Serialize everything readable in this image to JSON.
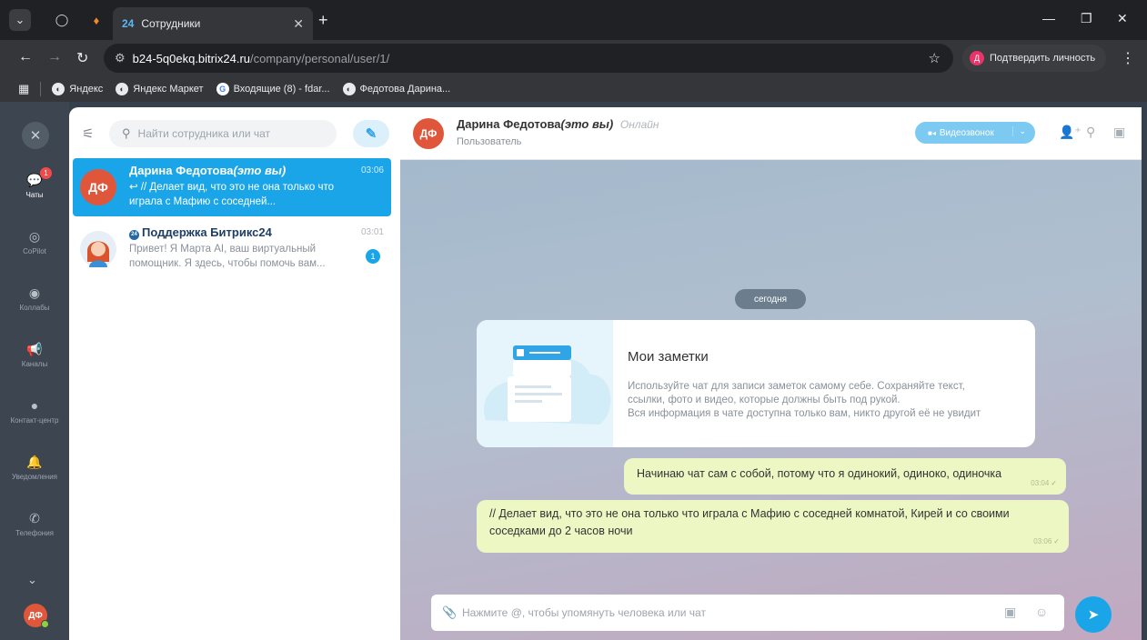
{
  "browser": {
    "tab_title": "Сотрудники",
    "tab_favicon": "24",
    "url_host": "b24-5q0ekq.bitrix24.ru",
    "url_path": "/company/personal/user/1/",
    "verify_avatar": "Д",
    "verify_label": "Подтвердить личность",
    "bookmarks": [
      {
        "label": "Яндекс",
        "icon": "yandex-icon"
      },
      {
        "label": "Яндекс Маркет",
        "icon": "yandex-market-icon"
      },
      {
        "label": "Входящие (8) - fdar...",
        "icon": "google-icon"
      },
      {
        "label": "Федотова Дарина...",
        "icon": "globe-icon"
      }
    ]
  },
  "leftnav": {
    "items": [
      {
        "label": "Чаты",
        "icon": "chat-icon",
        "badge": "1",
        "active": true
      },
      {
        "label": "CoPilot",
        "icon": "copilot-icon"
      },
      {
        "label": "Коллабы",
        "icon": "collab-icon"
      },
      {
        "label": "Каналы",
        "icon": "megaphone-icon"
      },
      {
        "label": "Контакт-центр",
        "icon": "contact-center-icon"
      },
      {
        "label": "Уведомления",
        "icon": "bell-icon"
      },
      {
        "label": "Телефония",
        "icon": "phone-icon"
      }
    ],
    "user_initials": "ДФ"
  },
  "chatlist": {
    "search_placeholder": "Найти сотрудника или чат",
    "chats": [
      {
        "name": "Дарина Федотова",
        "name_suffix": "(это вы)",
        "initials": "ДФ",
        "time": "03:06",
        "preview": "// Делает вид, что это не она только что играла с Мафию с соседней...",
        "reply_mark": "↩"
      },
      {
        "name": "Поддержка Битрикс24",
        "badge": "24",
        "time": "03:01",
        "preview": "Привет! Я Марта AI, ваш виртуальный помощник. Я здесь, чтобы помочь вам...",
        "unread": "1"
      }
    ]
  },
  "chat": {
    "header": {
      "initials": "ДФ",
      "name": "Дарина Федотова",
      "name_suffix": "(это вы)",
      "status": "Онлайн",
      "subtitle": "Пользователь",
      "video_label": "Видеозвонок"
    },
    "day_label": "сегодня",
    "notes": {
      "title": "Мои заметки",
      "line1": "Используйте чат для записи заметок самому себе. Сохраняйте текст,",
      "line2": "ссылки, фото и видео, которые должны быть под рукой.",
      "line3": "Вся информация в чате доступна только вам, никто другой её не увидит"
    },
    "messages": [
      {
        "text": "Начинаю чат сам с собой, потому что я одинокий, одиноко, одиночка",
        "time": "03:04"
      },
      {
        "text": "// Делает вид, что это не она только что играла с Мафию с соседней комнатой, Кирей и со своими соседками до 2 часов ночи",
        "time": "03:06"
      }
    ],
    "input_placeholder": "Нажмите @, чтобы упомянуть человека или чат"
  },
  "colors": {
    "accent": "#1aa5e8",
    "avatar": "#e0563a",
    "message_bg": "#ecf7c4",
    "sidebar": "#3d4650"
  }
}
